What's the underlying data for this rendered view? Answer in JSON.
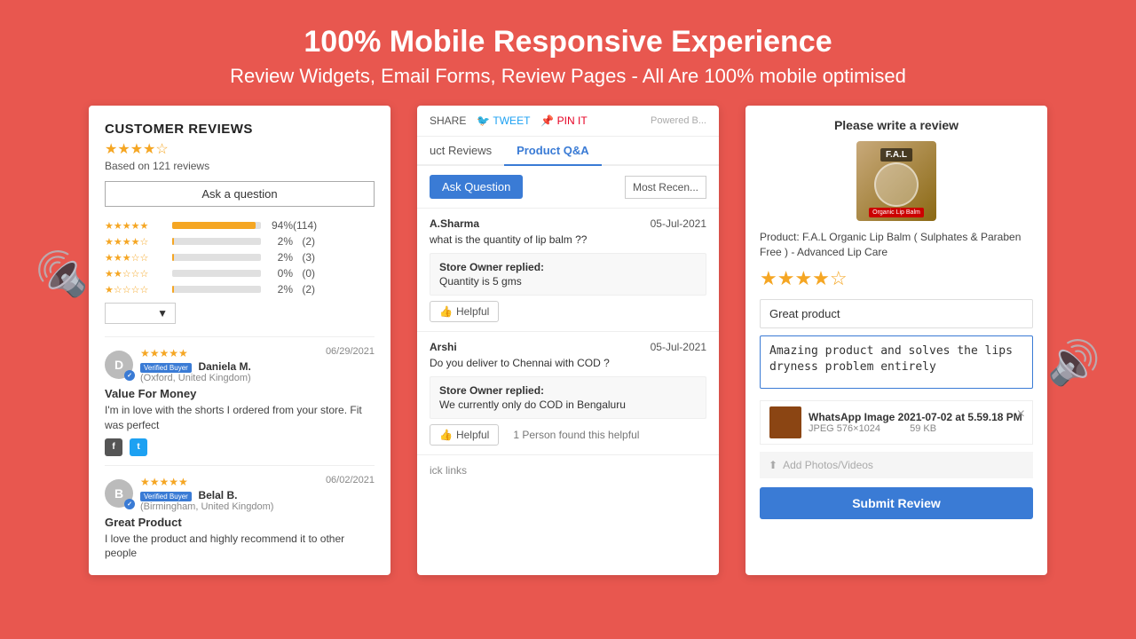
{
  "header": {
    "title": "100% Mobile Responsive Experience",
    "subtitle": "Review Widgets, Email Forms, Review Pages - All Are 100% mobile optimised"
  },
  "card1": {
    "title": "CUSTOMER REVIEWS",
    "stars": "★★★★☆",
    "based_on": "Based on 121 reviews",
    "ask_button": "Ask a question",
    "ratings": [
      {
        "stars": "★★★★★",
        "pct": "94%",
        "count": "(114)",
        "width": "94"
      },
      {
        "stars": "★★★★☆",
        "pct": "2%",
        "count": "(2)",
        "width": "2"
      },
      {
        "stars": "★★★☆☆",
        "pct": "2%",
        "count": "(3)",
        "width": "2"
      },
      {
        "stars": "★★☆☆☆",
        "pct": "0%",
        "count": "(0)",
        "width": "0"
      },
      {
        "stars": "★☆☆☆☆",
        "pct": "2%",
        "count": "(2)",
        "width": "2"
      }
    ],
    "reviews": [
      {
        "avatar_letter": "D",
        "date": "06/29/2021",
        "verified_label": "Verified Buyer",
        "name": "Daniela M.",
        "location": "(Oxford, United Kingdom)",
        "title": "Value For Money",
        "body": "I'm in love with the shorts I ordered from your store. Fit was perfect",
        "stars": "★★★★★"
      },
      {
        "avatar_letter": "B",
        "date": "06/02/2021",
        "verified_label": "Verified Buyer",
        "name": "Belal B.",
        "location": "(Birmingham, United Kingdom)",
        "title": "Great Product",
        "body": "I love the product and highly recommend it to other people",
        "stars": "★★★★★"
      }
    ]
  },
  "card2": {
    "share_label": "SHARE",
    "tweet_label": "TWEET",
    "pin_label": "PIN IT",
    "powered_label": "Powered B...",
    "tabs": [
      "uct Reviews",
      "Product Q&A"
    ],
    "active_tab": 1,
    "ask_question_btn": "Ask Question",
    "most_recent_label": "Most Recen...",
    "qas": [
      {
        "user": "A.Sharma",
        "date": "05-Jul-2021",
        "question": "what is the quantity of lip balm ??",
        "reply_title": "Store Owner replied:",
        "reply_body": "Quantity is 5 gms",
        "helpful_btn": "Helpful",
        "helpful_count": ""
      },
      {
        "user": "Arshi",
        "date": "05-Jul-2021",
        "question": "Do you deliver to Chennai with COD ?",
        "reply_title": "Store Owner replied:",
        "reply_body": "We currently only do COD in Bengaluru",
        "helpful_btn": "Helpful",
        "helpful_count": "1 Person found this helpful"
      }
    ]
  },
  "card3": {
    "title": "Please write a review",
    "product_name": "Product: F.A.L Organic Lip Balm ( Sulphates & Paraben Free ) - Advanced Lip Care",
    "stars": "★★★★☆",
    "review_title_placeholder": "Great product",
    "review_body_text": "Amazing product and solves the lips dryness problem entirely",
    "image_name": "WhatsApp Image 2021-07-02 at 5.59.18 PM",
    "image_type": "JPEG  576×1024",
    "image_size": "59 KB",
    "add_photos_label": "Add Photos/Videos",
    "submit_btn": "Submit Review"
  }
}
